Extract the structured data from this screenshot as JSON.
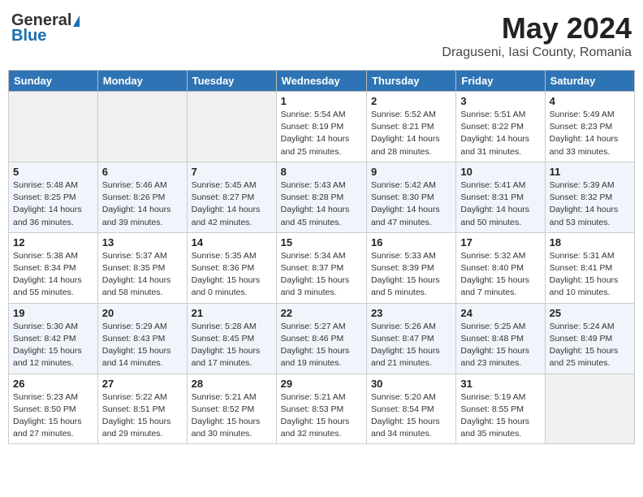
{
  "header": {
    "logo": {
      "general": "General",
      "blue": "Blue",
      "tagline": ""
    },
    "title": "May 2024",
    "location": "Draguseni, Iasi County, Romania"
  },
  "weekdays": [
    "Sunday",
    "Monday",
    "Tuesday",
    "Wednesday",
    "Thursday",
    "Friday",
    "Saturday"
  ],
  "weeks": [
    [
      {
        "day": "",
        "info": ""
      },
      {
        "day": "",
        "info": ""
      },
      {
        "day": "",
        "info": ""
      },
      {
        "day": "1",
        "info": "Sunrise: 5:54 AM\nSunset: 8:19 PM\nDaylight: 14 hours and 25 minutes."
      },
      {
        "day": "2",
        "info": "Sunrise: 5:52 AM\nSunset: 8:21 PM\nDaylight: 14 hours and 28 minutes."
      },
      {
        "day": "3",
        "info": "Sunrise: 5:51 AM\nSunset: 8:22 PM\nDaylight: 14 hours and 31 minutes."
      },
      {
        "day": "4",
        "info": "Sunrise: 5:49 AM\nSunset: 8:23 PM\nDaylight: 14 hours and 33 minutes."
      }
    ],
    [
      {
        "day": "5",
        "info": "Sunrise: 5:48 AM\nSunset: 8:25 PM\nDaylight: 14 hours and 36 minutes."
      },
      {
        "day": "6",
        "info": "Sunrise: 5:46 AM\nSunset: 8:26 PM\nDaylight: 14 hours and 39 minutes."
      },
      {
        "day": "7",
        "info": "Sunrise: 5:45 AM\nSunset: 8:27 PM\nDaylight: 14 hours and 42 minutes."
      },
      {
        "day": "8",
        "info": "Sunrise: 5:43 AM\nSunset: 8:28 PM\nDaylight: 14 hours and 45 minutes."
      },
      {
        "day": "9",
        "info": "Sunrise: 5:42 AM\nSunset: 8:30 PM\nDaylight: 14 hours and 47 minutes."
      },
      {
        "day": "10",
        "info": "Sunrise: 5:41 AM\nSunset: 8:31 PM\nDaylight: 14 hours and 50 minutes."
      },
      {
        "day": "11",
        "info": "Sunrise: 5:39 AM\nSunset: 8:32 PM\nDaylight: 14 hours and 53 minutes."
      }
    ],
    [
      {
        "day": "12",
        "info": "Sunrise: 5:38 AM\nSunset: 8:34 PM\nDaylight: 14 hours and 55 minutes."
      },
      {
        "day": "13",
        "info": "Sunrise: 5:37 AM\nSunset: 8:35 PM\nDaylight: 14 hours and 58 minutes."
      },
      {
        "day": "14",
        "info": "Sunrise: 5:35 AM\nSunset: 8:36 PM\nDaylight: 15 hours and 0 minutes."
      },
      {
        "day": "15",
        "info": "Sunrise: 5:34 AM\nSunset: 8:37 PM\nDaylight: 15 hours and 3 minutes."
      },
      {
        "day": "16",
        "info": "Sunrise: 5:33 AM\nSunset: 8:39 PM\nDaylight: 15 hours and 5 minutes."
      },
      {
        "day": "17",
        "info": "Sunrise: 5:32 AM\nSunset: 8:40 PM\nDaylight: 15 hours and 7 minutes."
      },
      {
        "day": "18",
        "info": "Sunrise: 5:31 AM\nSunset: 8:41 PM\nDaylight: 15 hours and 10 minutes."
      }
    ],
    [
      {
        "day": "19",
        "info": "Sunrise: 5:30 AM\nSunset: 8:42 PM\nDaylight: 15 hours and 12 minutes."
      },
      {
        "day": "20",
        "info": "Sunrise: 5:29 AM\nSunset: 8:43 PM\nDaylight: 15 hours and 14 minutes."
      },
      {
        "day": "21",
        "info": "Sunrise: 5:28 AM\nSunset: 8:45 PM\nDaylight: 15 hours and 17 minutes."
      },
      {
        "day": "22",
        "info": "Sunrise: 5:27 AM\nSunset: 8:46 PM\nDaylight: 15 hours and 19 minutes."
      },
      {
        "day": "23",
        "info": "Sunrise: 5:26 AM\nSunset: 8:47 PM\nDaylight: 15 hours and 21 minutes."
      },
      {
        "day": "24",
        "info": "Sunrise: 5:25 AM\nSunset: 8:48 PM\nDaylight: 15 hours and 23 minutes."
      },
      {
        "day": "25",
        "info": "Sunrise: 5:24 AM\nSunset: 8:49 PM\nDaylight: 15 hours and 25 minutes."
      }
    ],
    [
      {
        "day": "26",
        "info": "Sunrise: 5:23 AM\nSunset: 8:50 PM\nDaylight: 15 hours and 27 minutes."
      },
      {
        "day": "27",
        "info": "Sunrise: 5:22 AM\nSunset: 8:51 PM\nDaylight: 15 hours and 29 minutes."
      },
      {
        "day": "28",
        "info": "Sunrise: 5:21 AM\nSunset: 8:52 PM\nDaylight: 15 hours and 30 minutes."
      },
      {
        "day": "29",
        "info": "Sunrise: 5:21 AM\nSunset: 8:53 PM\nDaylight: 15 hours and 32 minutes."
      },
      {
        "day": "30",
        "info": "Sunrise: 5:20 AM\nSunset: 8:54 PM\nDaylight: 15 hours and 34 minutes."
      },
      {
        "day": "31",
        "info": "Sunrise: 5:19 AM\nSunset: 8:55 PM\nDaylight: 15 hours and 35 minutes."
      },
      {
        "day": "",
        "info": ""
      }
    ]
  ]
}
